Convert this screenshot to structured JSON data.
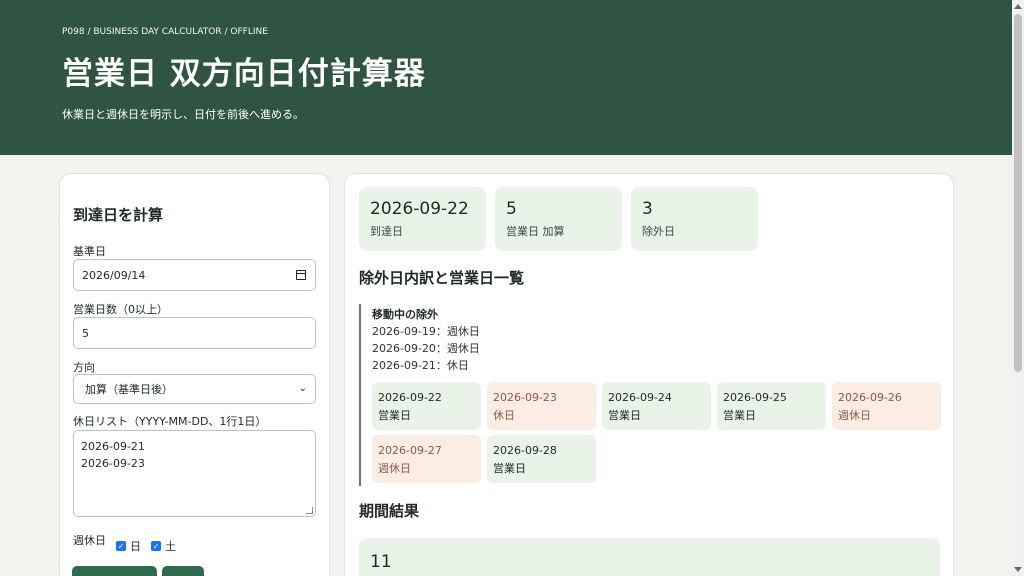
{
  "header": {
    "eyebrow": "P098 / BUSINESS DAY CALCULATOR / OFFLINE",
    "title": "営業日 双方向日付計算器",
    "subtitle": "休業日と週休日を明示し、日付を前後へ進める。"
  },
  "form": {
    "heading": "到達日を計算",
    "base_date_label": "基準日",
    "base_date_value": "2026/09/14",
    "days_label": "営業日数（0以上）",
    "days_value": "5",
    "direction_label": "方向",
    "direction_value": "加算（基準日後）",
    "holidays_label": "休日リスト（YYYY-MM-DD、1行1日）",
    "holidays": [
      "2026-09-21",
      "2026-09-23"
    ],
    "weekly_label": "週休日",
    "weekly_days": [
      {
        "label": "日",
        "checked": true
      },
      {
        "label": "土",
        "checked": true
      }
    ]
  },
  "stats": [
    {
      "value": "2026-09-22",
      "label": "到達日"
    },
    {
      "value": "5",
      "label": "営業日 加算"
    },
    {
      "value": "3",
      "label": "除外日"
    }
  ],
  "breakdown": {
    "heading": "除外日内訳と営業日一覧",
    "sub_heading": "移動中の除外",
    "exclusions": [
      "2026-09-19：週休日",
      "2026-09-20：週休日",
      "2026-09-21：休日"
    ],
    "days": [
      {
        "date": "2026-09-22",
        "kind": "営業日",
        "status": "biz"
      },
      {
        "date": "2026-09-23",
        "kind": "休日",
        "status": "off"
      },
      {
        "date": "2026-09-24",
        "kind": "営業日",
        "status": "biz"
      },
      {
        "date": "2026-09-25",
        "kind": "営業日",
        "status": "biz"
      },
      {
        "date": "2026-09-26",
        "kind": "週休日",
        "status": "off"
      },
      {
        "date": "2026-09-27",
        "kind": "週休日",
        "status": "off"
      },
      {
        "date": "2026-09-28",
        "kind": "営業日",
        "status": "biz"
      }
    ]
  },
  "period": {
    "heading": "期間結果",
    "value": "11"
  },
  "colors": {
    "header_bg": "#2f5441",
    "business_day_bg": "#eaf3e8",
    "off_day_bg": "#fbece4",
    "button_bg": "#2f6b4e"
  }
}
